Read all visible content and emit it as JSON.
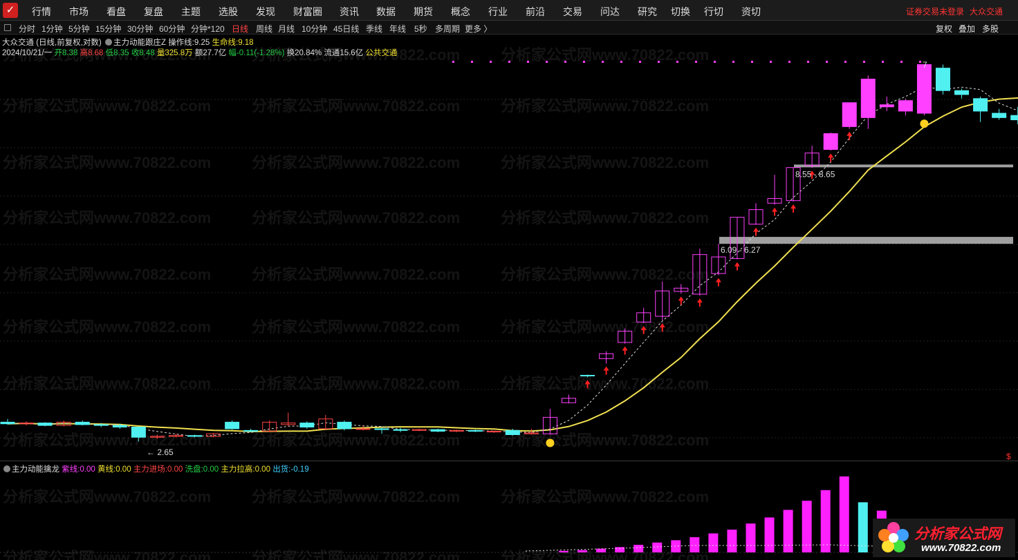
{
  "menu": {
    "logo_char": "✓",
    "items": [
      "行情",
      "市场",
      "看盘",
      "复盘",
      "主题",
      "选股",
      "发现",
      "财富圈",
      "资讯",
      "数据",
      "期货",
      "概念",
      "行业",
      "前沿",
      "交易",
      "问达",
      "研究",
      "切换",
      "行切",
      "资切"
    ],
    "login_status": "证券交易未登录",
    "stock_name": "大众交通"
  },
  "periods": {
    "items": [
      "分时",
      "1分钟",
      "5分钟",
      "15分钟",
      "30分钟",
      "60分钟",
      "分钟*120",
      "日线",
      "周线",
      "月线",
      "10分钟",
      "45日线",
      "季线",
      "年线",
      "5秒",
      "多周期",
      "更多 〉"
    ],
    "active_index": 7
  },
  "tools": [
    "复权",
    "叠加",
    "多股"
  ],
  "info": {
    "title": "大众交通 (日线,前复权,对数)",
    "indicator_name": "主力动能跟庄Z",
    "op_line_label": "操作线:",
    "op_line_value": "9.25",
    "life_line_label": "生命线:",
    "life_line_value": "9.18",
    "date": "2024/10/21/一",
    "open_label": "开",
    "open": "8.38",
    "high_label": "高",
    "high": "8.68",
    "low_label": "低",
    "low": "8.35",
    "close_label": "收",
    "close": "8.48",
    "volume_label": "量",
    "volume": "325.8万",
    "amount_label": "额",
    "amount": "27.7亿",
    "change_label": "幅",
    "change": "-0.11(-1.28%)",
    "turnover_label": "换",
    "turnover": "20.84%",
    "float_label": "流通",
    "float": "15.6亿",
    "exchange": "公共交通"
  },
  "indicator": {
    "name": "主力动能擒龙",
    "purple_label": "紫线:",
    "purple": "0.00",
    "yellow_label": "黄线:",
    "yellow": "0.00",
    "entry_label": "主力进场:",
    "entry": "0.00",
    "wash_label": "洗盘:",
    "wash": "0.00",
    "pull_label": "主力拉高:",
    "pull": "0.00",
    "sell_label": "出货:",
    "sell": "-0.19"
  },
  "chart_data": {
    "type": "candlestick",
    "price_labels": {
      "low_marker": "2.65",
      "zone1": "6.09 - 6.27",
      "zone2": "8.55 - 8.65",
      "top_marker": "7",
      "dollar_marker": "$"
    },
    "candles": [
      {
        "o": 2.88,
        "h": 2.92,
        "l": 2.85,
        "c": 2.86
      },
      {
        "o": 2.86,
        "h": 2.89,
        "l": 2.84,
        "c": 2.87
      },
      {
        "o": 2.87,
        "h": 2.88,
        "l": 2.83,
        "c": 2.84
      },
      {
        "o": 2.84,
        "h": 2.9,
        "l": 2.83,
        "c": 2.88
      },
      {
        "o": 2.88,
        "h": 2.9,
        "l": 2.84,
        "c": 2.85
      },
      {
        "o": 2.85,
        "h": 2.87,
        "l": 2.82,
        "c": 2.84
      },
      {
        "o": 2.84,
        "h": 2.86,
        "l": 2.8,
        "c": 2.82
      },
      {
        "o": 2.82,
        "h": 2.83,
        "l": 2.65,
        "c": 2.7
      },
      {
        "o": 2.7,
        "h": 2.73,
        "l": 2.68,
        "c": 2.71
      },
      {
        "o": 2.71,
        "h": 2.74,
        "l": 2.7,
        "c": 2.72
      },
      {
        "o": 2.72,
        "h": 2.73,
        "l": 2.7,
        "c": 2.71
      },
      {
        "o": 2.71,
        "h": 2.75,
        "l": 2.7,
        "c": 2.74
      },
      {
        "o": 2.88,
        "h": 2.9,
        "l": 2.79,
        "c": 2.8
      },
      {
        "o": 2.78,
        "h": 2.8,
        "l": 2.76,
        "c": 2.77
      },
      {
        "o": 2.77,
        "h": 2.9,
        "l": 2.76,
        "c": 2.88
      },
      {
        "o": 2.85,
        "h": 3.0,
        "l": 2.83,
        "c": 2.87
      },
      {
        "o": 2.87,
        "h": 2.89,
        "l": 2.8,
        "c": 2.82
      },
      {
        "o": 2.8,
        "h": 2.97,
        "l": 2.79,
        "c": 2.92
      },
      {
        "o": 2.88,
        "h": 2.9,
        "l": 2.78,
        "c": 2.8
      },
      {
        "o": 2.8,
        "h": 2.84,
        "l": 2.78,
        "c": 2.8
      },
      {
        "o": 2.8,
        "h": 2.82,
        "l": 2.74,
        "c": 2.79
      },
      {
        "o": 2.79,
        "h": 2.81,
        "l": 2.76,
        "c": 2.78
      },
      {
        "o": 2.78,
        "h": 2.8,
        "l": 2.77,
        "c": 2.79
      },
      {
        "o": 2.79,
        "h": 2.8,
        "l": 2.76,
        "c": 2.77
      },
      {
        "o": 2.77,
        "h": 2.79,
        "l": 2.76,
        "c": 2.78
      },
      {
        "o": 2.78,
        "h": 2.79,
        "l": 2.76,
        "c": 2.77
      },
      {
        "o": 2.77,
        "h": 2.78,
        "l": 2.75,
        "c": 2.77
      },
      {
        "o": 2.78,
        "h": 2.8,
        "l": 2.72,
        "c": 2.73
      },
      {
        "o": 2.74,
        "h": 2.8,
        "l": 2.73,
        "c": 2.75
      },
      {
        "o": 2.74,
        "h": 3.05,
        "l": 2.73,
        "c": 2.94
      },
      {
        "o": 3.13,
        "h": 3.24,
        "l": 3.12,
        "c": 3.19
      },
      {
        "o": 3.52,
        "h": 3.53,
        "l": 3.49,
        "c": 3.51
      },
      {
        "o": 3.78,
        "h": 3.9,
        "l": 3.7,
        "c": 3.86
      },
      {
        "o": 4.05,
        "h": 4.3,
        "l": 4.03,
        "c": 4.25
      },
      {
        "o": 4.42,
        "h": 4.7,
        "l": 4.4,
        "c": 4.6
      },
      {
        "o": 4.53,
        "h": 5.26,
        "l": 4.45,
        "c": 5.05
      },
      {
        "o": 5.04,
        "h": 5.2,
        "l": 4.99,
        "c": 5.11
      },
      {
        "o": 4.98,
        "h": 6.05,
        "l": 4.95,
        "c": 5.9
      },
      {
        "o": 5.44,
        "h": 6.18,
        "l": 5.4,
        "c": 5.84
      },
      {
        "o": 5.8,
        "h": 6.92,
        "l": 5.78,
        "c": 6.92
      },
      {
        "o": 6.72,
        "h": 7.35,
        "l": 6.7,
        "c": 7.15
      },
      {
        "o": 7.35,
        "h": 8.3,
        "l": 7.3,
        "c": 7.5
      },
      {
        "o": 7.43,
        "h": 8.55,
        "l": 7.4,
        "c": 8.56
      },
      {
        "o": 8.63,
        "h": 9.4,
        "l": 8.55,
        "c": 9.11
      },
      {
        "o": 9.25,
        "h": 9.95,
        "l": 9.2,
        "c": 9.9
      },
      {
        "o": 10.2,
        "h": 11.2,
        "l": 10.1,
        "c": 11.3
      },
      {
        "o": 10.6,
        "h": 12.7,
        "l": 10.1,
        "c": 12.5
      },
      {
        "o": 11.1,
        "h": 11.6,
        "l": 10.9,
        "c": 11.2
      },
      {
        "o": 10.9,
        "h": 11.5,
        "l": 10.7,
        "c": 11.4
      },
      {
        "o": 10.8,
        "h": 13.3,
        "l": 10.7,
        "c": 13.3
      },
      {
        "o": 13.1,
        "h": 13.3,
        "l": 11.7,
        "c": 11.9
      },
      {
        "o": 11.9,
        "h": 12.0,
        "l": 11.5,
        "c": 11.7
      },
      {
        "o": 11.5,
        "h": 11.6,
        "l": 10.4,
        "c": 10.9
      },
      {
        "o": 10.8,
        "h": 11.0,
        "l": 10.5,
        "c": 10.6
      },
      {
        "o": 10.7,
        "h": 11.1,
        "l": 10.3,
        "c": 10.5
      },
      {
        "o": 10.5,
        "h": 10.5,
        "l": 9.5,
        "c": 9.9
      }
    ],
    "indicator_bars": [
      {
        "v": 0.02,
        "t": "m"
      },
      {
        "v": 0.03,
        "t": "m"
      },
      {
        "v": 0.05,
        "t": "m"
      },
      {
        "v": 0.07,
        "t": "m"
      },
      {
        "v": 0.1,
        "t": "m"
      },
      {
        "v": 0.13,
        "t": "m"
      },
      {
        "v": 0.16,
        "t": "m"
      },
      {
        "v": 0.2,
        "t": "m"
      },
      {
        "v": 0.25,
        "t": "m"
      },
      {
        "v": 0.3,
        "t": "m"
      },
      {
        "v": 0.38,
        "t": "m"
      },
      {
        "v": 0.46,
        "t": "m"
      },
      {
        "v": 0.56,
        "t": "m"
      },
      {
        "v": 0.68,
        "t": "m"
      },
      {
        "v": 0.82,
        "t": "m"
      },
      {
        "v": 1.0,
        "t": "m"
      },
      {
        "v": 0.66,
        "t": "c"
      },
      {
        "v": 0.55,
        "t": "m"
      }
    ]
  },
  "watermark": "分析家公式网www.70822.com",
  "brand": {
    "name": "分析家公式网",
    "url": "www.70822.com"
  }
}
